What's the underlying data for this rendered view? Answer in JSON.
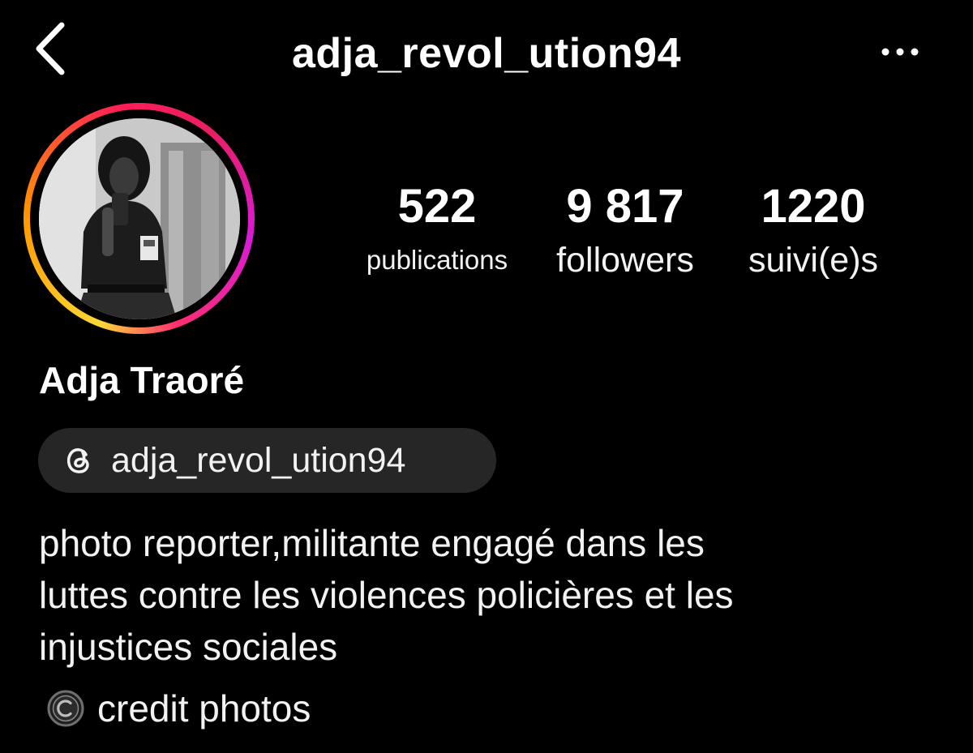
{
  "header": {
    "username": "adja_revol_ution94",
    "back_icon": "chevron-left-icon",
    "more_icon": "more-horizontal-icon"
  },
  "profile": {
    "avatar_icon": "profile-photo",
    "story_ring_colors": [
      "#fdd835",
      "#ff9800",
      "#ff1e56",
      "#e91e63",
      "#d81bd8"
    ],
    "display_name": "Adja Traoré",
    "threads_icon": "threads-icon",
    "threads_handle": "adja_revol_ution94"
  },
  "stats": {
    "posts": {
      "value": "522",
      "label": "publications"
    },
    "followers": {
      "value": "9 817",
      "label": "followers"
    },
    "following": {
      "value": "1220",
      "label": "suivi(e)s"
    }
  },
  "bio": {
    "lines": [
      "photo reporter,militante engagé dans les",
      "luttes contre les violences policières et les",
      "injustices sociales"
    ],
    "credit_icon": "copyright-icon",
    "credit_text": "credit photos"
  },
  "colors": {
    "background": "#000000",
    "pill": "#262626",
    "text": "#f2f2f2"
  }
}
